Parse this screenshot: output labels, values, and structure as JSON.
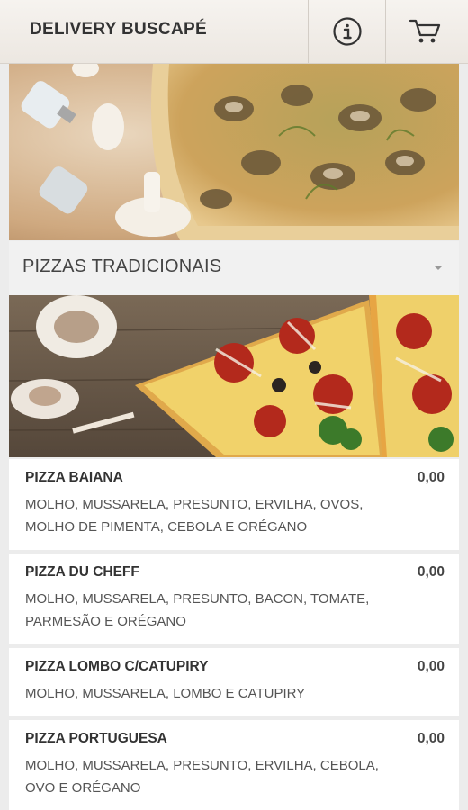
{
  "header": {
    "title": "DELIVERY BUSCAPÉ",
    "info_icon": "info-icon",
    "cart_icon": "cart-icon"
  },
  "category": {
    "title": "PIZZAS TRADICIONAIS",
    "chevron_icon": "chevron-down-icon"
  },
  "items": [
    {
      "name": "PIZZA BAIANA",
      "price": "0,00",
      "description": "MOLHO, MUSSARELA, PRESUNTO, ERVILHA, OVOS, MOLHO DE PIMENTA, CEBOLA E ORÉGANO"
    },
    {
      "name": "PIZZA DU CHEFF",
      "price": "0,00",
      "description": "MOLHO, MUSSARELA, PRESUNTO, BACON, TOMATE, PARMESÃO E ORÉGANO"
    },
    {
      "name": "PIZZA LOMBO C/CATUPIRY",
      "price": "0,00",
      "description": "MOLHO, MUSSARELA, LOMBO E CATUPIRY"
    },
    {
      "name": "PIZZA PORTUGUESA",
      "price": "0,00",
      "description": "MOLHO, MUSSARELA, PRESUNTO, ERVILHA, CEBOLA, OVO E ORÉGANO"
    }
  ]
}
